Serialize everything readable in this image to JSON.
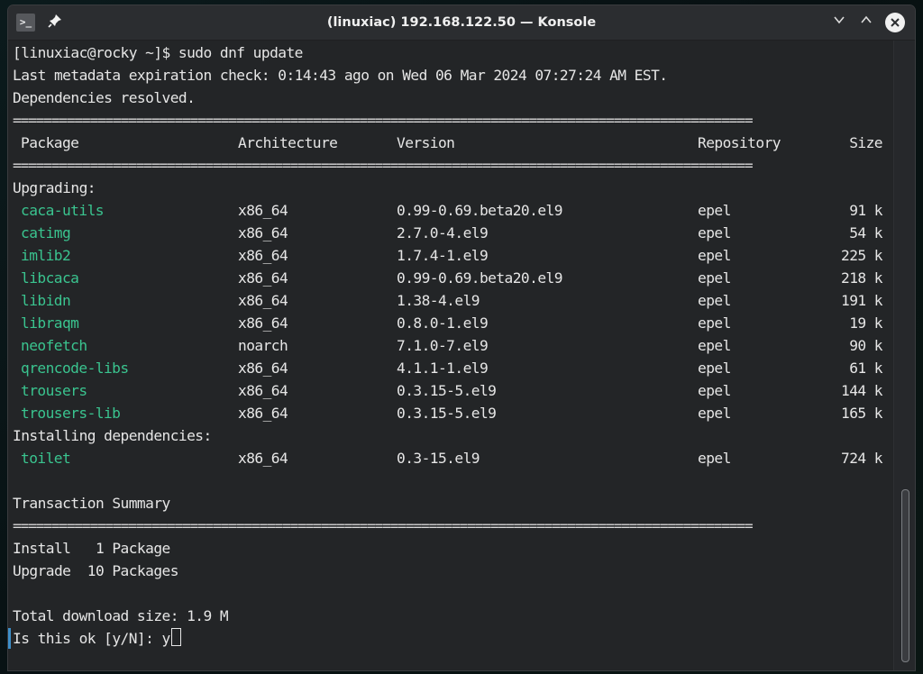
{
  "window": {
    "title": "(linuxiac) 192.168.122.50 — Konsole",
    "icons": {
      "app": "terminal-icon",
      "pin": "pin-icon",
      "minimize": "chevron-down-icon",
      "maximize": "chevron-up-icon",
      "close": "close-icon"
    },
    "glyphs": {
      "app": ">_",
      "pin": "📌",
      "minimize": "∨",
      "maximize": "∧",
      "close": "✕"
    }
  },
  "terminal": {
    "prompt": "[linuxiac@rocky ~]$ sudo dnf update",
    "metadata": "Last metadata expiration check: 0:14:43 ago on Wed 06 Mar 2024 07:27:24 AM EST.",
    "resolved": "Dependencies resolved.",
    "rule": "================================================================================================",
    "headers": {
      "package": "Package",
      "arch": "Architecture",
      "version": "Version",
      "repo": "Repository",
      "size": "Size"
    },
    "upgrading_label": "Upgrading:",
    "upgrading": [
      {
        "name": "caca-utils",
        "arch": "x86_64",
        "version": "0.99-0.69.beta20.el9",
        "repo": "epel",
        "size": "91 k"
      },
      {
        "name": "catimg",
        "arch": "x86_64",
        "version": "2.7.0-4.el9",
        "repo": "epel",
        "size": "54 k"
      },
      {
        "name": "imlib2",
        "arch": "x86_64",
        "version": "1.7.4-1.el9",
        "repo": "epel",
        "size": "225 k"
      },
      {
        "name": "libcaca",
        "arch": "x86_64",
        "version": "0.99-0.69.beta20.el9",
        "repo": "epel",
        "size": "218 k"
      },
      {
        "name": "libidn",
        "arch": "x86_64",
        "version": "1.38-4.el9",
        "repo": "epel",
        "size": "191 k"
      },
      {
        "name": "libraqm",
        "arch": "x86_64",
        "version": "0.8.0-1.el9",
        "repo": "epel",
        "size": "19 k"
      },
      {
        "name": "neofetch",
        "arch": "noarch",
        "version": "7.1.0-7.el9",
        "repo": "epel",
        "size": "90 k"
      },
      {
        "name": "qrencode-libs",
        "arch": "x86_64",
        "version": "4.1.1-1.el9",
        "repo": "epel",
        "size": "61 k"
      },
      {
        "name": "trousers",
        "arch": "x86_64",
        "version": "0.3.15-5.el9",
        "repo": "epel",
        "size": "144 k"
      },
      {
        "name": "trousers-lib",
        "arch": "x86_64",
        "version": "0.3.15-5.el9",
        "repo": "epel",
        "size": "165 k"
      }
    ],
    "installing_label": "Installing dependencies:",
    "installing": [
      {
        "name": "toilet",
        "arch": "x86_64",
        "version": "0.3-15.el9",
        "repo": "epel",
        "size": "724 k"
      }
    ],
    "summary_title": "Transaction Summary",
    "summary_install": "Install   1 Package",
    "summary_upgrade": "Upgrade  10 Packages",
    "total_download": "Total download size: 1.9 M",
    "confirm_prompt": "Is this ok [y/N]: ",
    "confirm_input": "y"
  },
  "colors": {
    "package_name": "#3ac48f",
    "background": "#232527",
    "text": "#e6e6e6",
    "prompt_marker": "#3d8fc9"
  }
}
